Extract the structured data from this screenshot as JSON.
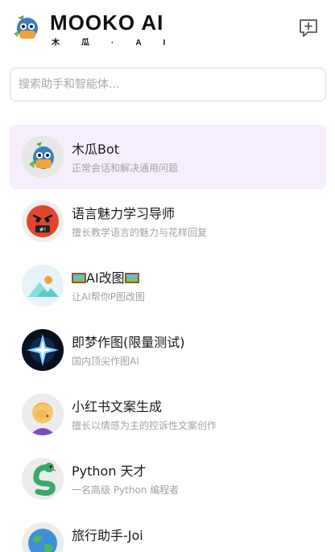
{
  "header": {
    "brand_name": "MOOKO AI",
    "brand_sub": "木瓜·AI",
    "new_chat_icon": "new-chat-icon",
    "logo_icon": "mooko-logo-icon"
  },
  "search": {
    "placeholder": "搜索助手和智能体..."
  },
  "bots": [
    {
      "name": "木瓜Bot",
      "desc": "正常会话和解决通用问题",
      "avatar": "mugua-robot-avatar",
      "active": true
    },
    {
      "name": "语言魅力学习导师",
      "desc": "擅长教学语言的魅力与花样回复",
      "avatar": "angry-face-avatar"
    },
    {
      "name_prefix": "",
      "name_core": "AI改图",
      "name_suffix": "",
      "desc": "让AI帮你P图改图",
      "avatar": "image-landscape-avatar",
      "name_icon": "framed-picture-icon"
    },
    {
      "name": "即梦作图(限量测试)",
      "desc": "国内顶尖作图AI",
      "avatar": "sparkle-star-avatar"
    },
    {
      "name": "小红书文案生成",
      "desc": "擅长以情感为主的控诉性文案创作",
      "avatar": "facepalm-person-avatar"
    },
    {
      "name": "Python 天才",
      "desc": "一名高级 Python 编程者",
      "avatar": "python-snake-avatar"
    },
    {
      "name": "旅行助手-Joi",
      "desc": "",
      "avatar": "globe-avatar"
    }
  ],
  "colors": {
    "active_bg": "#f6eefc",
    "desc_text": "#a3a3a3",
    "border": "#d9d9d9"
  }
}
